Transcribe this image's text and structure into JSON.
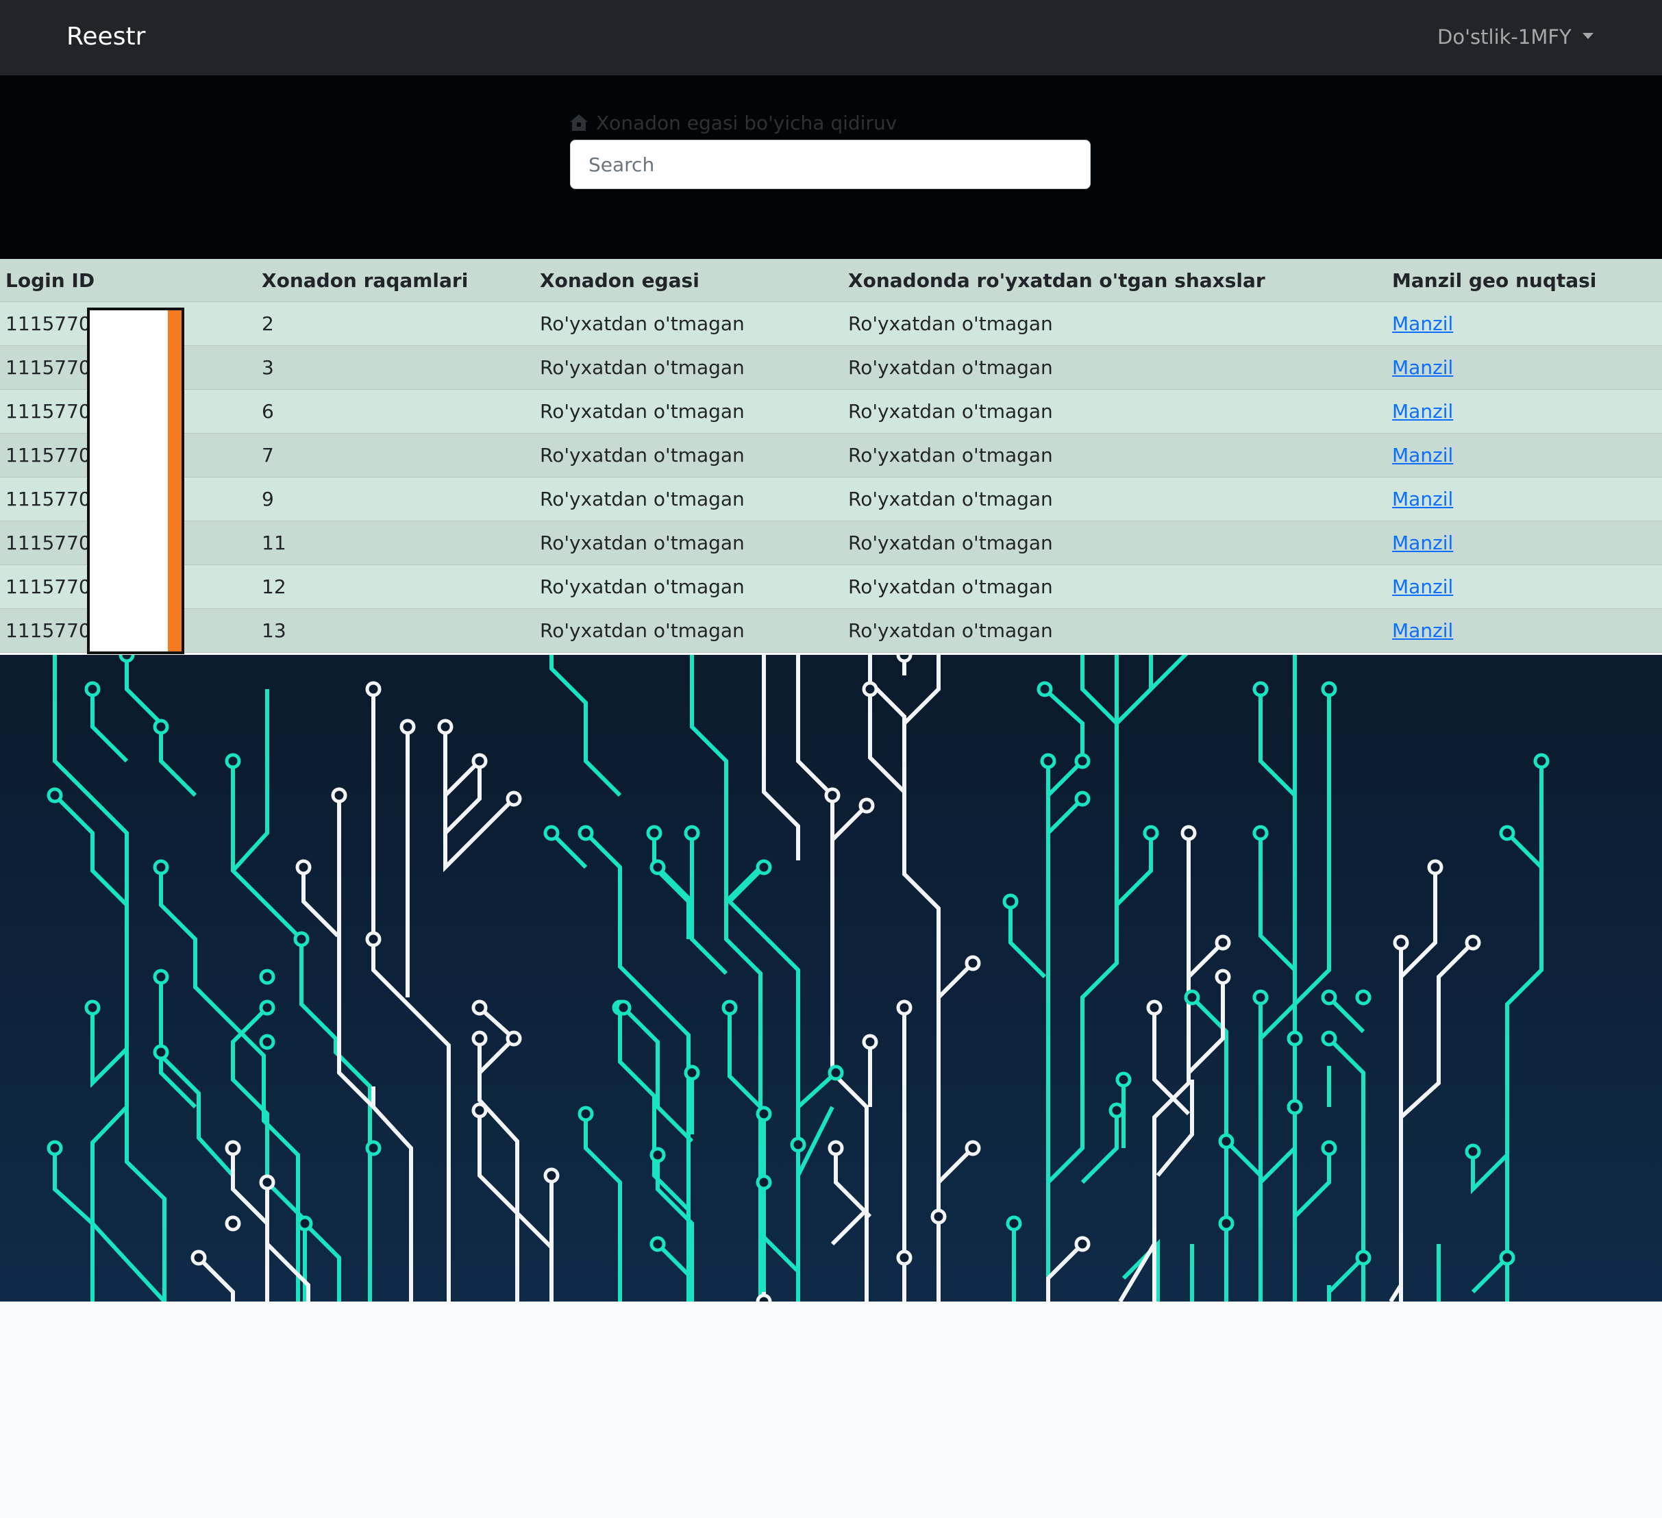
{
  "navbar": {
    "brand": "Reestr",
    "dropdown_label": "Do'stlik-1MFY"
  },
  "search": {
    "label": "Xonadon egasi bo'yicha qidiruv",
    "placeholder": "Search",
    "value": ""
  },
  "table": {
    "headers": [
      "Login ID",
      "Xonadon raqamlari",
      "Xonadon egasi",
      "Xonadonda ro'yxatdan o'tgan shaxslar",
      "Manzil geo nuqtasi"
    ],
    "rows": [
      {
        "login_id": "1115770",
        "number": "2",
        "owner": "Ro'yxatdan o'tmagan",
        "registered": "Ro'yxatdan o'tmagan",
        "geo": "Manzil"
      },
      {
        "login_id": "1115770",
        "number": "3",
        "owner": "Ro'yxatdan o'tmagan",
        "registered": "Ro'yxatdan o'tmagan",
        "geo": "Manzil"
      },
      {
        "login_id": "1115770",
        "number": "6",
        "owner": "Ro'yxatdan o'tmagan",
        "registered": "Ro'yxatdan o'tmagan",
        "geo": "Manzil"
      },
      {
        "login_id": "1115770",
        "number": "7",
        "owner": "Ro'yxatdan o'tmagan",
        "registered": "Ro'yxatdan o'tmagan",
        "geo": "Manzil"
      },
      {
        "login_id": "1115770",
        "number": "9",
        "owner": "Ro'yxatdan o'tmagan",
        "registered": "Ro'yxatdan o'tmagan",
        "geo": "Manzil"
      },
      {
        "login_id": "1115770",
        "number": "11",
        "owner": "Ro'yxatdan o'tmagan",
        "registered": "Ro'yxatdan o'tmagan",
        "geo": "Manzil"
      },
      {
        "login_id": "1115770",
        "number": "12",
        "owner": "Ro'yxatdan o'tmagan",
        "registered": "Ro'yxatdan o'tmagan",
        "geo": "Manzil"
      },
      {
        "login_id": "1115770",
        "number": "13",
        "owner": "Ro'yxatdan o'tmagan",
        "registered": "Ro'yxatdan o'tmagan",
        "geo": "Manzil"
      }
    ]
  },
  "icons": {
    "search_label_icon": "home-icon",
    "dropdown_icon": "caret-down-icon"
  },
  "colors": {
    "navbar_bg": "#212529",
    "hero_bg": "#020507",
    "row_odd": "#d1e7dd",
    "row_even": "#c7dbd2",
    "link": "#0d6efd",
    "circuit_bg_top": "#0b1a2c",
    "circuit_bg_bottom": "#0f2a47",
    "circuit_teal": "#19e3c0",
    "circuit_white": "#f2f4f6",
    "redaction_bar": "#f47b20"
  }
}
